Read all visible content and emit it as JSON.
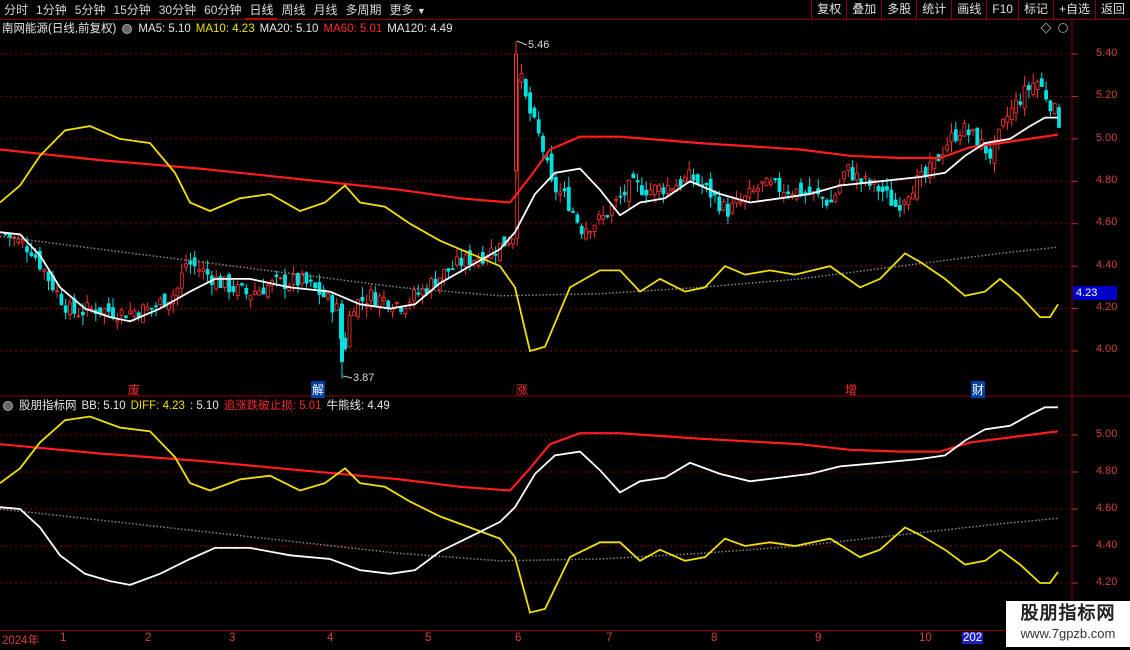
{
  "toolbar": {
    "periods": [
      "分时",
      "1分钟",
      "5分钟",
      "15分钟",
      "30分钟",
      "60分钟",
      "日线",
      "周线",
      "月线",
      "多周期",
      "更多"
    ],
    "active_period": "日线",
    "buttons": [
      "复权",
      "叠加",
      "多股",
      "统计",
      "画线",
      "F10",
      "标记",
      "+自选",
      "返回"
    ]
  },
  "main_legend": {
    "title": "南网能源(日线,前复权)",
    "ma5": "MA5: 5.10",
    "ma10": "MA10: 4.23",
    "ma20": "MA20: 5.10",
    "ma60": "MA60: 5.01",
    "ma120": "MA120: 4.49"
  },
  "sub_legend": {
    "title": "股朋指标网",
    "bb": "BB: 5.10",
    "diff": "DIFF: 4.23",
    "val": ": 5.10",
    "stop": "追涨跌破止损: 5.01",
    "bull": "牛熊线: 4.49"
  },
  "main_axis": [
    "5.40",
    "5.20",
    "5.00",
    "4.80",
    "4.60",
    "4.40",
    "4.20",
    "4.00"
  ],
  "sub_axis": [
    "5.00",
    "4.80",
    "4.60",
    "4.40",
    "4.20"
  ],
  "current_price_tag": "4.23",
  "annotations": {
    "high": "5.46",
    "low": "3.87"
  },
  "event_markers": [
    "废",
    "解",
    "涨",
    "增",
    "财"
  ],
  "date_axis": [
    "2024年",
    "1",
    "2",
    "3",
    "4",
    "5",
    "6",
    "7",
    "8",
    "9",
    "10",
    "202"
  ],
  "watermark": {
    "name": "股朋指标网",
    "url": "www.7gpzb.com"
  },
  "colors": {
    "up": "#ff3232",
    "down": "#00e0e0",
    "ma_white": "#ffffff",
    "ma_yellow": "#f0e000",
    "ma_red": "#ff1e1e",
    "grid": "#8a0000"
  }
}
